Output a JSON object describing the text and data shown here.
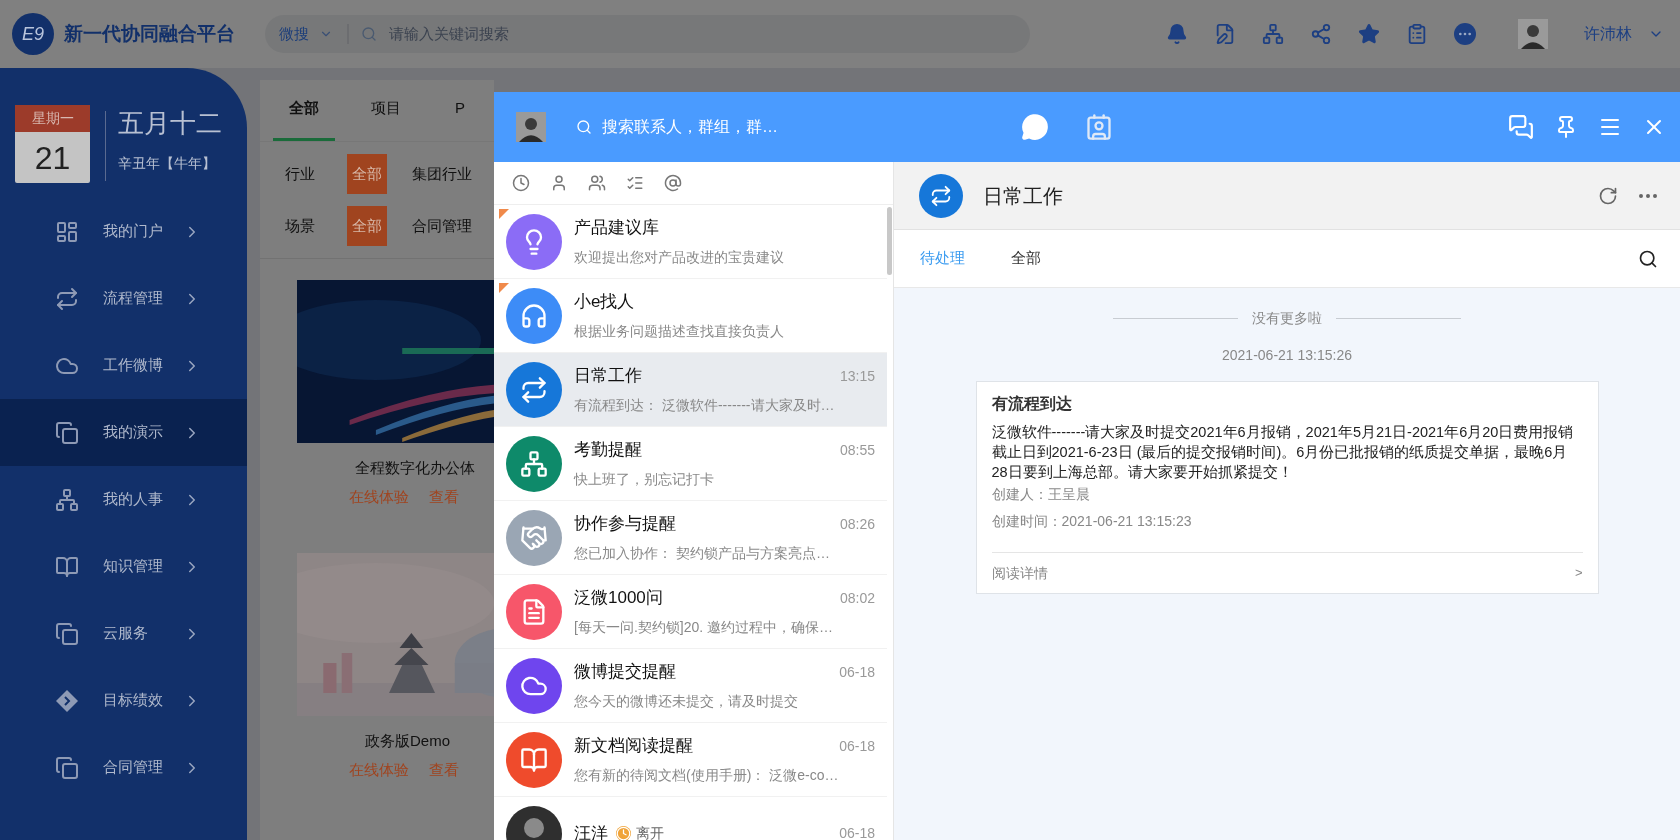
{
  "app": {
    "logo": "E9",
    "title": "新一代协同融合平台",
    "search": {
      "scope": "微搜",
      "placeholder": "请输入关键词搜索"
    },
    "user": {
      "name": "许沛林"
    }
  },
  "calendar": {
    "weekday": "星期一",
    "day": "21",
    "lunar_date": "五月十二",
    "lunar_year": "辛丑年【牛年】"
  },
  "sidebar": {
    "items": [
      {
        "label": "我的门户",
        "selected": false
      },
      {
        "label": "流程管理",
        "selected": false
      },
      {
        "label": "工作微博",
        "selected": false
      },
      {
        "label": "我的演示",
        "selected": true
      },
      {
        "label": "我的人事",
        "selected": false
      },
      {
        "label": "知识管理",
        "selected": false
      },
      {
        "label": "云服务",
        "selected": false
      },
      {
        "label": "目标绩效",
        "selected": false
      },
      {
        "label": "合同管理",
        "selected": false
      }
    ]
  },
  "content": {
    "tabs": [
      {
        "label": "全部",
        "selected": true
      },
      {
        "label": "项目",
        "selected": false
      },
      {
        "label": "P",
        "selected": false
      }
    ],
    "filters": [
      {
        "label": "行业",
        "options": [
          {
            "label": "全部",
            "selected": true
          },
          {
            "label": "集团行业",
            "selected": false
          }
        ]
      },
      {
        "label": "场景",
        "options": [
          {
            "label": "全部",
            "selected": true
          },
          {
            "label": "合同管理",
            "selected": false
          }
        ]
      }
    ],
    "cards": [
      {
        "title": "全程数字化办公体",
        "links": [
          "在线体验",
          "查看"
        ]
      },
      {
        "title": "政务版Demo",
        "links": [
          "在线体验",
          "查看"
        ]
      }
    ]
  },
  "chat": {
    "search_placeholder": "搜索联系人，群组，群…",
    "conversations": [
      {
        "name": "产品建议库",
        "preview": "欢迎提出您对产品改进的宝贵建议",
        "flagged": true,
        "selected": false,
        "kind": "icon",
        "color": "#8b6cf6"
      },
      {
        "name": "小e找人",
        "preview": "根据业务问题描述查找直接负责人",
        "flagged": true,
        "selected": false,
        "kind": "icon",
        "color": "#3d8cf7"
      },
      {
        "name": "日常工作",
        "time": "13:15",
        "preview": "有流程到达： 泛微软件-------请大家及时…",
        "flagged": false,
        "selected": true,
        "kind": "icon",
        "color": "#1677d9"
      },
      {
        "name": "考勤提醒",
        "time": "08:55",
        "preview": "快上班了，别忘记打卡",
        "flagged": false,
        "selected": false,
        "kind": "icon",
        "color": "#0e8a6a"
      },
      {
        "name": "协作参与提醒",
        "time": "08:26",
        "preview": "您已加入协作： 契约锁产品与方案亮点…",
        "flagged": false,
        "selected": false,
        "kind": "icon",
        "color": "#9aa6b4"
      },
      {
        "name": "泛微1000问",
        "time": "08:02",
        "preview": "[每天一问.契约锁]20. 邀约过程中，确保…",
        "flagged": false,
        "selected": false,
        "kind": "icon",
        "color": "#f7566a"
      },
      {
        "name": "微博提交提醒",
        "time": "06-18",
        "preview": "您今天的微博还未提交，请及时提交",
        "flagged": false,
        "selected": false,
        "kind": "icon",
        "color": "#6f45ee"
      },
      {
        "name": "新文档阅读提醒",
        "time": "06-18",
        "preview": "您有新的待阅文档(使用手册)： 泛微e-co…",
        "flagged": false,
        "selected": false,
        "kind": "icon",
        "color": "#ef4b2c"
      },
      {
        "name": "汪洋",
        "status": "离开",
        "time": "06-18",
        "flagged": false,
        "selected": false,
        "color": "#2f2f2f"
      }
    ],
    "detail": {
      "title": "日常工作",
      "tabs": [
        {
          "label": "待处理",
          "selected": true
        },
        {
          "label": "全部",
          "selected": false
        }
      ],
      "end_note": "没有更多啦",
      "timestamp": "2021-06-21 13:15:26",
      "message": {
        "title": "有流程到达",
        "body": "泛微软件-------请大家及时提交2021年6月报销，2021年5月21日-2021年6月20日费用报销截止日到2021-6-23日 (最后的提交报销时间)。6月份已批报销的纸质提交单据，最晚6月28日要到上海总部。请大家要开始抓紧提交！",
        "creator": "创建人：王呈晨",
        "created_time": "创建时间：2021-06-21 13:15:23",
        "link": "阅读详情",
        "arrow": ">"
      }
    }
  }
}
